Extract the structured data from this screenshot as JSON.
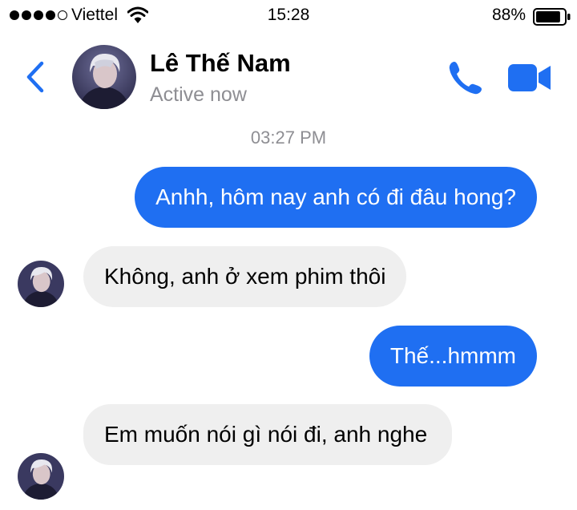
{
  "status_bar": {
    "carrier": "Viettel",
    "time": "15:28",
    "battery_percent": "88%",
    "battery_level": 0.88,
    "signal_bars_filled": 4,
    "signal_bars_total": 5
  },
  "header": {
    "contact_name": "Lê Thế Nam",
    "status": "Active now",
    "icons": {
      "back": "chevron-left-icon",
      "call": "phone-icon",
      "video": "video-camera-icon"
    }
  },
  "conversation": {
    "timestamp": "03:27 PM",
    "messages": [
      {
        "direction": "out",
        "text": "Anhh, hôm nay anh có đi đâu hong?"
      },
      {
        "direction": "in",
        "text": "Không, anh ở xem phim thôi"
      },
      {
        "direction": "out",
        "text": "Thế...hmmm"
      },
      {
        "direction": "in",
        "text": "Em muốn nói gì nói đi, anh nghe"
      }
    ]
  },
  "colors": {
    "accent": "#1f6ff2",
    "incoming_bubble": "#efefef",
    "secondary_text": "#8e8e93"
  }
}
